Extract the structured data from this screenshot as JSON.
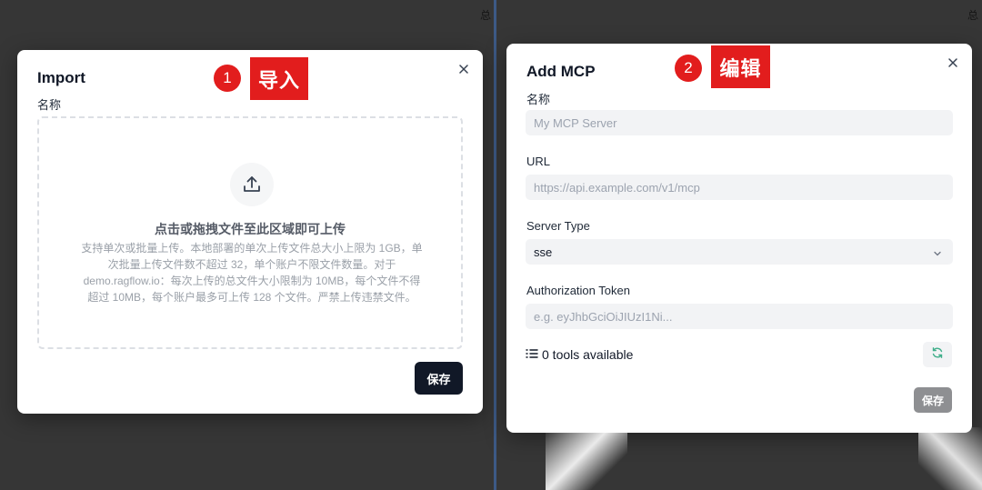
{
  "background": {
    "corner_left": "总",
    "corner_right": "总"
  },
  "import_modal": {
    "title": "Import",
    "step_number": "1",
    "step_tag": "导入",
    "name_label": "名称",
    "dropzone": {
      "title": "点击或拖拽文件至此区域即可上传",
      "description_lines": [
        "支持单次或批量上传。本地部署的单次上传文件总大小上限为 1GB，单",
        "次批量上传文件数不超过 32，单个账户不限文件数量。对于",
        "demo.ragflow.io：每次上传的总文件大小限制为 10MB，每个文件不得",
        "超过 10MB，每个账户最多可上传 128 个文件。严禁上传违禁文件。"
      ]
    },
    "save_label": "保存",
    "icons": {
      "close": "close-icon",
      "upload": "upload-icon"
    }
  },
  "mcp_modal": {
    "title": "Add MCP",
    "step_number": "2",
    "step_tag": "编辑",
    "name_label": "名称",
    "name_placeholder": "My MCP Server",
    "url_label": "URL",
    "url_placeholder": "https://api.example.com/v1/mcp",
    "server_type_label": "Server Type",
    "server_type_value": "sse",
    "auth_label": "Authorization Token",
    "auth_placeholder": "e.g. eyJhbGciOiJIUzI1Ni...",
    "tools_text": "0 tools available",
    "save_label": "保存",
    "icons": {
      "close": "close-icon",
      "list": "list-icon",
      "refresh": "refresh-icon",
      "chevron": "chevron-down-icon"
    }
  },
  "colors": {
    "accent_red": "#e21d1d",
    "dark_button": "#111827",
    "disabled_button": "#8e8f92",
    "divider": "#3d5a86"
  }
}
